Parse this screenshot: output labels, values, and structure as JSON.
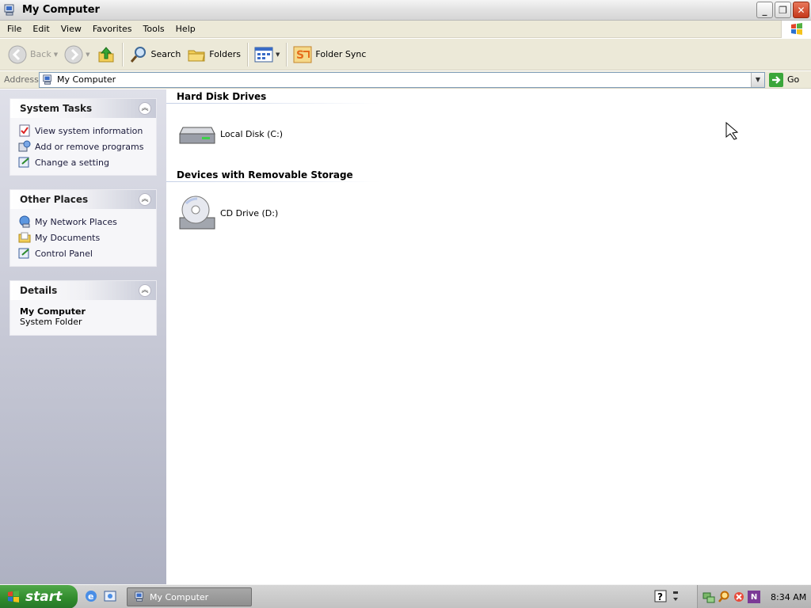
{
  "window": {
    "title": "My Computer"
  },
  "menu": [
    "File",
    "Edit",
    "View",
    "Favorites",
    "Tools",
    "Help"
  ],
  "toolbar": {
    "back_label": "Back",
    "search_label": "Search",
    "folders_label": "Folders",
    "folder_sync_label": "Folder Sync"
  },
  "address": {
    "label": "Address",
    "value": "My Computer",
    "go_label": "Go"
  },
  "left_panel": {
    "system_tasks": {
      "title": "System Tasks",
      "items": [
        "View system information",
        "Add or remove programs",
        "Change a setting"
      ]
    },
    "other_places": {
      "title": "Other Places",
      "items": [
        "My Network Places",
        "My Documents",
        "Control Panel"
      ]
    },
    "details": {
      "title": "Details",
      "name": "My Computer",
      "type": "System Folder"
    }
  },
  "content": {
    "groups": [
      {
        "title": "Hard Disk Drives",
        "items": [
          "Local Disk (C:)"
        ]
      },
      {
        "title": "Devices with Removable Storage",
        "items": [
          "CD Drive (D:)"
        ]
      }
    ]
  },
  "taskbar": {
    "start_label": "start",
    "window_label": "My Computer",
    "clock": "8:34 AM",
    "tray_n_label": "N"
  },
  "icons": {
    "app": "my-computer-icon",
    "back": "back-arrow-icon",
    "forward": "forward-arrow-icon",
    "up": "up-folder-icon",
    "search": "search-icon",
    "folders": "folders-icon",
    "views": "views-icon",
    "folder_sync": "folder-sync-icon",
    "go": "go-arrow-icon",
    "hard_disk": "hard-disk-icon",
    "cd_drive": "cd-drive-icon"
  },
  "colors": {
    "start_green": "#3c9a38",
    "close_red": "#c4381a",
    "left_panel_bg": "#c7c9d6"
  }
}
